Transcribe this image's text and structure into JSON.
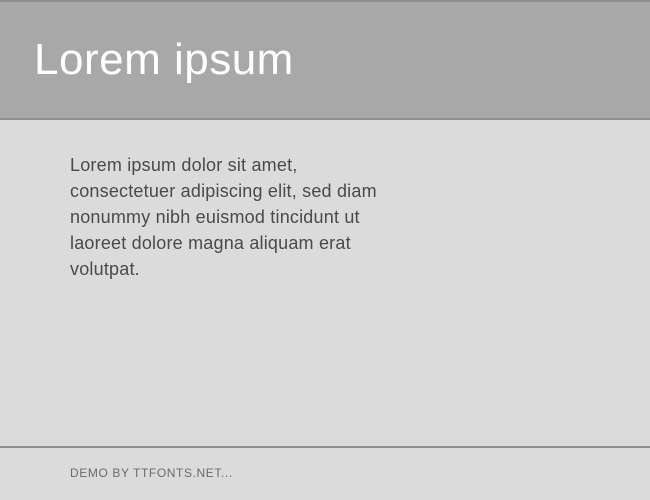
{
  "header": {
    "title": "Lorem ipsum"
  },
  "content": {
    "body": "Lorem ipsum dolor sit amet, consectetuer adipiscing elit, sed diam nonummy nibh euismod tincidunt ut laoreet dolore magna aliquam erat volutpat."
  },
  "footer": {
    "text": "DEMO BY TTFONTS.NET..."
  }
}
